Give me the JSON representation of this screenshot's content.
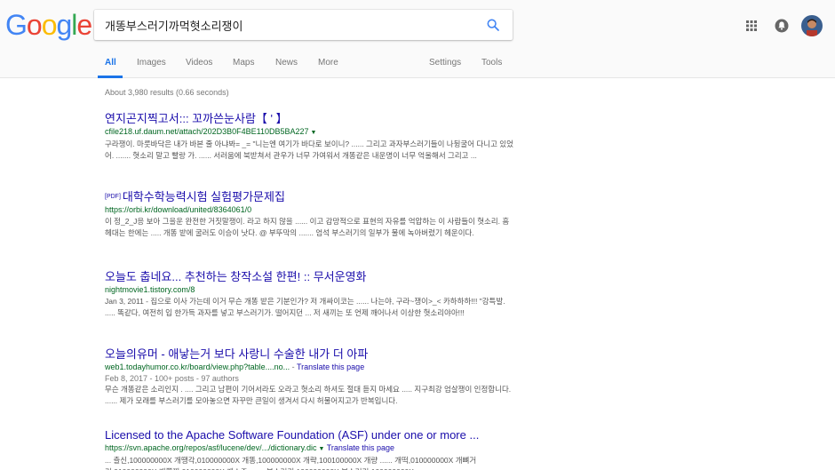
{
  "logo": {
    "letters": [
      "G",
      "o",
      "o",
      "g",
      "l",
      "e"
    ],
    "colors": [
      "#4285F4",
      "#EA4335",
      "#FBBC05",
      "#4285F4",
      "#34A853",
      "#EA4335"
    ]
  },
  "search": {
    "query": "개똥부스러기까먹혓소리쟁이"
  },
  "tabs": {
    "all": "All",
    "images": "Images",
    "videos": "Videos",
    "maps": "Maps",
    "news": "News",
    "more": "More",
    "settings": "Settings",
    "tools": "Tools"
  },
  "stats": "About 3,980 results (0.66 seconds)",
  "results": [
    {
      "title": "연지곤지찍고서::: 꼬까쓴눈사람【 ' 】",
      "url": "cfile218.uf.daum.net/attach/202D3B0F4BE110DB5BA227",
      "caret": "▼",
      "snippet": "구라쟁이. 마룻바닥은 내가 바본 줄 아냐봐= _= \"니는엔 여기가 바다로 보이니? ...... 그리고 과자부스러기들이 나뒹굴어 다니고 있었어. ....... 혓소리 말고 빨랑 가. ...... 서러움에 북받쳐서 관우가 너무 가여워서 개똥같은 내운명이 너무 억울해서 그리고 ..."
    },
    {
      "pdf": "[PDF]",
      "title": "대학수학능력시험 실험평가문제집",
      "url": "https://orbi.kr/download/united/8364061/0",
      "snippet": "이 정_2_J응 보아 그을운 완전한 거짓말쟁이. 라고 하지 않을 ...... 이고 감망적으로 표현의 자유를 억압하는 이 사람들이 혓소리. 흠 헤대는 한에는 ..... 개똥 밭에 굴러도 이승이 낫다. @ 부뚜막의 ....... 엄석 부스러기의 일부가 물에 녹아버렸기 헤운이다."
    },
    {
      "title": "오늘도 춥네요... 추천하는 창작소설 한편! :: 무서운영화",
      "url": "nightmovie1.tistory.com/8",
      "snippet": "Jan 3, 2011 - 집으로 이사 가는데 이거 무슨 개똥 밭은 기분인가? 저 개싸이코는 ...... 나는야, 구라~쟁이>_< 카하하하!!! \"강특발. ..... 똑같다, 여전히 입 한가득 과자를 넣고 부스러기가. 떨어지던 ... 저 새끼는 또 언제 깨어나서 이상한 혓소리야아!!!"
    },
    {
      "title": "오늘의유머 - 애낳는거 보다 사랑니 수술한 내가 더 아파",
      "url": "web1.todayhumor.co.kr/board/view.php?table....no...",
      "sep": " - ",
      "translate": "Translate this page",
      "date": "Feb 8, 2017 - 100+ posts - 97 authors",
      "snippet": "무슨 개똥같은 소리인지 . .... 그리고 남편이 기어서라도 오라고 혓소리 하셔도 절대 듣지 마세요 ..... 지구최강 엄살쟁이 인정합니다. ...... 제가 모래를 부스러기를 모아놓으면 자꾸만 큰일이 생겨서 다시 허물어지고가 반복입니다."
    },
    {
      "title": "Licensed to the Apache Software Foundation (ASF) under one or more ...",
      "url": "https://svn.apache.org/repos/asf/lucene/dev/.../dictionary.dic",
      "caret": "▼",
      "translate": "Translate this page",
      "snippet": "... 츨신,100000000X 개땡각,010000000X 개똥,100000000X 개략,100100000X 개량 ...... 개떡,010000000X 개뼈거리,010000000X 개뿔찌,010000000X 개소주 ....... 부스러기,100000000X 부스러기,100000000X"
    }
  ]
}
